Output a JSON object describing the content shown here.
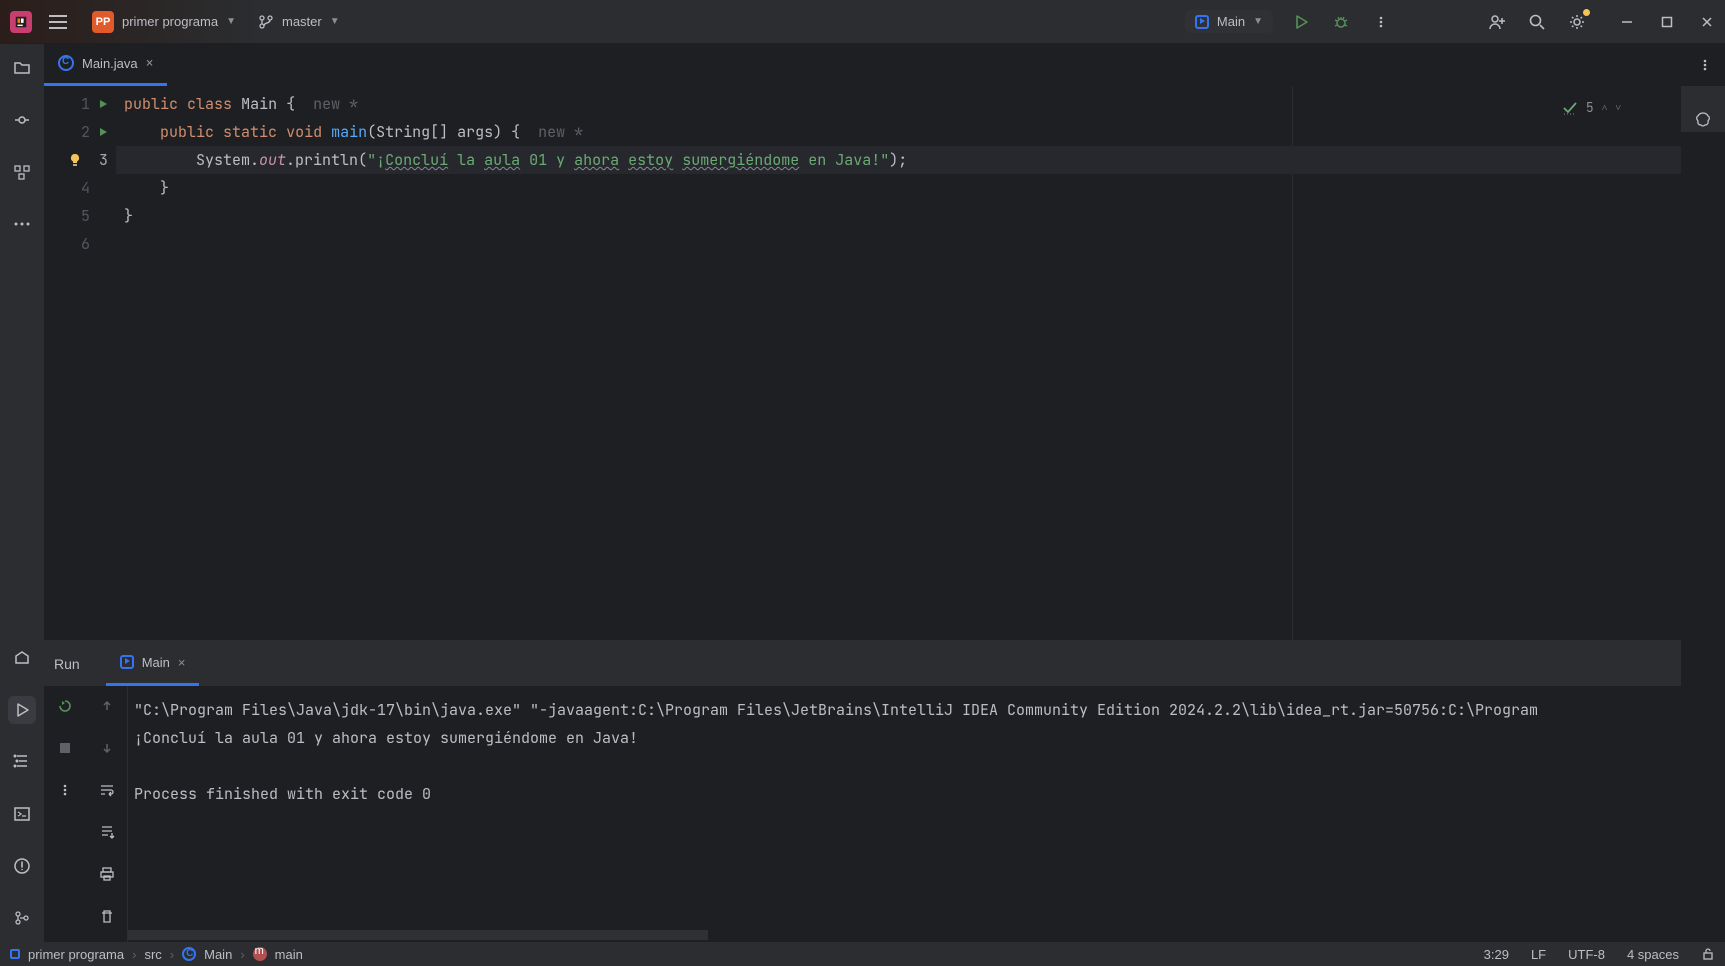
{
  "top": {
    "project_badge": "PP",
    "project_name": "primer programa",
    "branch": "master",
    "run_config": "Main"
  },
  "tab": {
    "filename": "Main.java"
  },
  "problems": {
    "count": "5"
  },
  "code": {
    "l1": {
      "kw1": "public",
      "kw2": "class",
      "name": "Main",
      "brace": " {",
      "inlay": "  new *"
    },
    "l2": {
      "indent": "    ",
      "kw1": "public",
      "kw2": "static",
      "kw3": "void",
      "fn": "main",
      "args": "(String[] args)",
      "brace": " {",
      "inlay": "  new *"
    },
    "l3": {
      "indent": "        ",
      "sys": "System.",
      "out": "out",
      "dot": ".println(",
      "q1": "\"¡",
      "w1": "Concluí",
      "s1": " la ",
      "w2": "aula",
      "s2": " 01 y ",
      "w3": "ahora",
      "s3": " ",
      "w4": "estoy",
      "s4": " ",
      "w5": "sumergiéndome",
      "tail": " en Java!\"",
      "end": ");"
    },
    "l4": {
      "indent": "    ",
      "brace": "}"
    },
    "l5": {
      "brace": "}"
    }
  },
  "run": {
    "title": "Run",
    "tab": "Main",
    "line1": "\"C:\\Program Files\\Java\\jdk-17\\bin\\java.exe\" \"-javaagent:C:\\Program Files\\JetBrains\\IntelliJ IDEA Community Edition 2024.2.2\\lib\\idea_rt.jar=50756:C:\\Program",
    "line2": "¡Concluí la aula 01 y ahora estoy sumergiéndome en Java!",
    "line3": "Process finished with exit code 0"
  },
  "breadcrumb": {
    "a": "primer programa",
    "b": "src",
    "c": "Main",
    "d": "main"
  },
  "status": {
    "pos": "3:29",
    "eol": "LF",
    "enc": "UTF-8",
    "indent": "4 spaces"
  }
}
